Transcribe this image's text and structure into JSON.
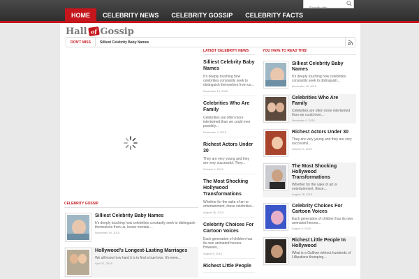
{
  "nav": {
    "items": [
      {
        "label": "HOME",
        "active": true
      },
      {
        "label": "CELEBRITY NEWS",
        "active": false
      },
      {
        "label": "CELEBRITY GOSSIP",
        "active": false
      },
      {
        "label": "CELEBRITY FACTS",
        "active": false
      }
    ],
    "search_placeholder": "Search site"
  },
  "colors": {
    "accent": "#c4161c",
    "nav_bg": "#3a3a3a"
  },
  "logo": {
    "part1": "Hall",
    "part2": "of",
    "part3": "Gossip"
  },
  "ticker": {
    "label": "DON'T MISS",
    "text": "Silliest Celebrity Baby Names"
  },
  "gossip": {
    "title": "CELEBRITY GOSSIP",
    "posts": [
      {
        "title": "Silliest Celebrity Baby Names",
        "excerpt": "It's deeply touching how celebrities constantly seek to distinguish themselves from us, lesser mortals....",
        "date": "November 19, 2015",
        "thumb": "baby-photo"
      },
      {
        "title": "Hollywood's Longest-Lasting Marriages",
        "excerpt": "We all know how hard it is to find a true love. It's even...",
        "date": "April 21, 2015",
        "thumb": "couple-photo"
      }
    ]
  },
  "latest": {
    "title": "LATEST CELEBRITY NEWS",
    "posts": [
      {
        "title": "Silliest Celebrity Baby Names",
        "excerpt": "It's deeply touching how celebrities constantly seek to distinguish themselves from us...",
        "date": "November 19, 2015"
      },
      {
        "title": "Celebrities Who Are Family",
        "excerpt": "Celebrities are often more intertwined than we could ever possibly...",
        "date": "November 4, 2015"
      },
      {
        "title": "Richest Actors Under 30",
        "excerpt": "They are very young and they are very successful. They...",
        "date": "October 4, 2015"
      },
      {
        "title": "The Most Shocking Hollywood Transformations",
        "excerpt": "Whether for the sake of art or entertainment, these celebrities...",
        "date": "August 26, 2015"
      },
      {
        "title": "Celebrity Choices For Cartoon Voices",
        "excerpt": "Each generation of children has its own animated heroes. However,...",
        "date": "August 6, 2015"
      },
      {
        "title": "Richest Little People",
        "excerpt": "",
        "date": ""
      }
    ]
  },
  "must_read": {
    "title": "YOU HAVE TO READ THIS!",
    "posts": [
      {
        "title": "Silliest Celebrity Baby Names",
        "excerpt": "It's deeply touching how celebrities constantly seek to distinguish...",
        "date": "November 19, 2015",
        "thumb": "baby-photo"
      },
      {
        "title": "Celebrities Who Are Family",
        "excerpt": "Celebrities are often more intertwined than we could ever...",
        "date": "November 4, 2015",
        "thumb": "women-photo"
      },
      {
        "title": "Richest Actors Under 30",
        "excerpt": "They are very young and they are very successful...",
        "date": "October 4, 2015",
        "thumb": "redhead-photo"
      },
      {
        "title": "The Most Shocking Hollywood Transformations",
        "excerpt": "Whether for the sake of art or entertainment, these...",
        "date": "August 26, 2015",
        "thumb": "man-photo"
      },
      {
        "title": "Celebrity Choices For Cartoon Voices",
        "excerpt": "Each generation of children has its own animated heroes...",
        "date": "August 6, 2015",
        "thumb": "cartoon-photo"
      },
      {
        "title": "Richest Little People In Hollywood",
        "excerpt": "What is a Gulliver without hundreds of Lilliputians thumping...",
        "date": "",
        "thumb": "actor-photo"
      }
    ]
  }
}
